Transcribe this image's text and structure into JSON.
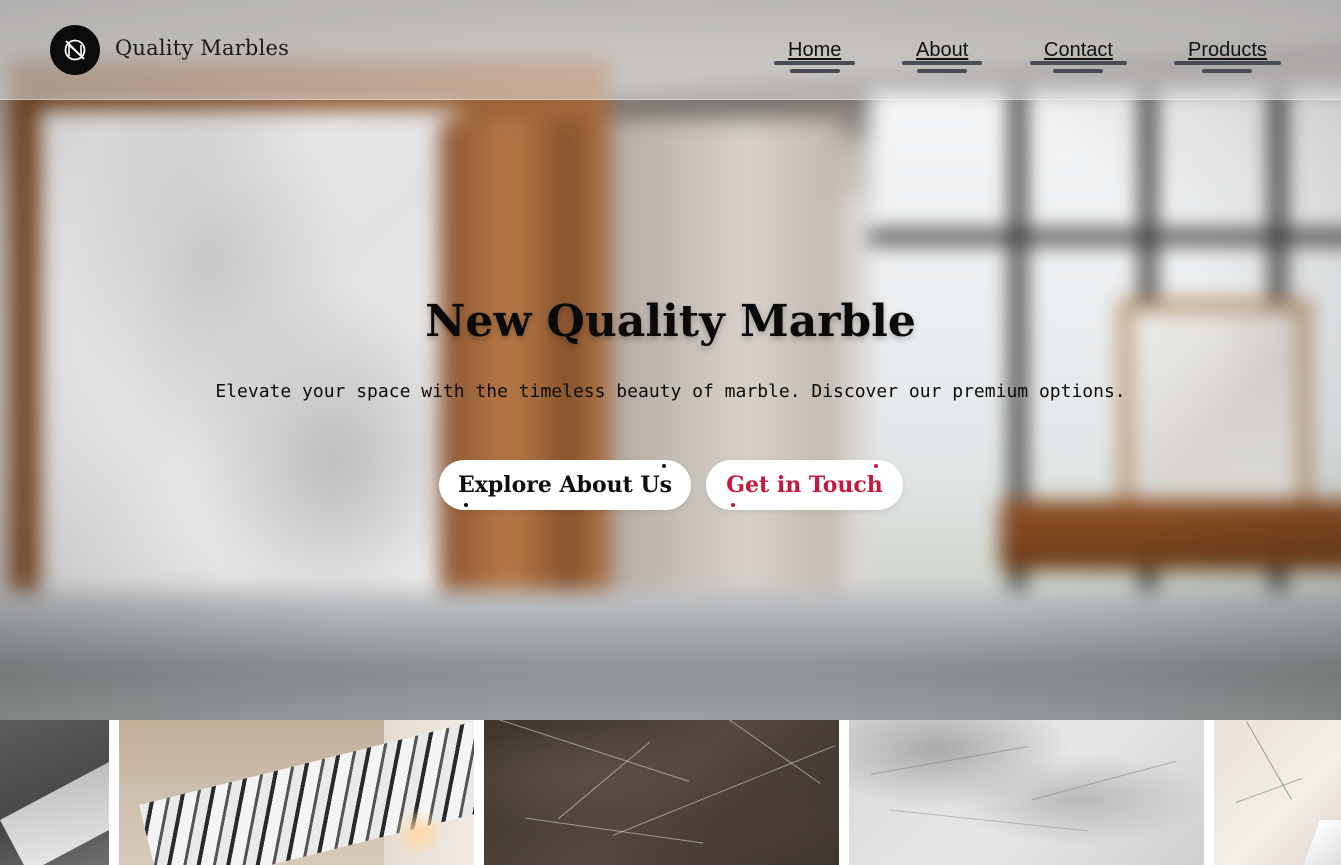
{
  "brand": {
    "name": "Quality Marbles",
    "logo_icon": "circle-slash-icon"
  },
  "nav": {
    "items": [
      {
        "label": "Home"
      },
      {
        "label": "About"
      },
      {
        "label": "Contact"
      },
      {
        "label": "Products"
      }
    ]
  },
  "hero": {
    "title": "New Quality Marble",
    "subtitle": "Elevate your space with the timeless beauty of marble. Discover our premium options.",
    "buttons": {
      "explore_label": "Explore About Us",
      "touch_label": "Get in Touch"
    }
  },
  "gallery": {
    "tiles": [
      "dark-grey-marble",
      "white-black-marble-counter",
      "brown-emperador-marble",
      "grey-white-marble",
      "cream-marble"
    ]
  },
  "colors": {
    "accent": "#c8173f",
    "text_dark": "#0d0d0d",
    "logo_bg": "#0b0b0b",
    "nav_underline": "#4a4c55"
  }
}
